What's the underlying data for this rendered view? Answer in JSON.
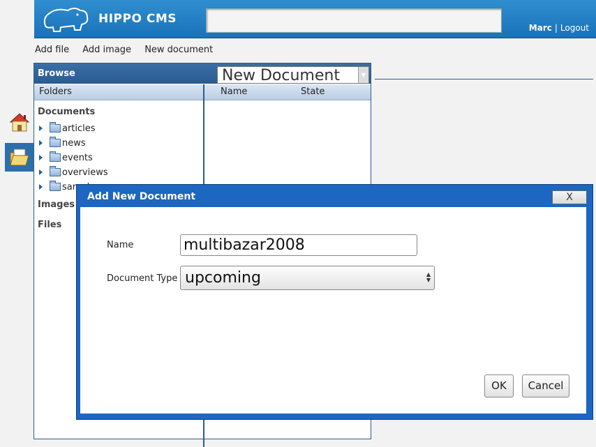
{
  "header": {
    "logo_text": "HIPPO CMS",
    "search_value": "",
    "user": "Marc",
    "separator": "|",
    "logout": "Logout"
  },
  "actions": [
    "Add file",
    "Add image",
    "New document"
  ],
  "browse": {
    "title": "Browse",
    "new_document_select": "New Document",
    "folders_label": "Folders",
    "columns": [
      "Name",
      "State"
    ],
    "tree": {
      "documents_label": "Documents",
      "folders": [
        "articles",
        "news",
        "events",
        "overviews",
        "sample"
      ],
      "images_label": "Images",
      "files_label": "Files"
    }
  },
  "dialog": {
    "title": "Add New Document",
    "close_label": "X",
    "name_label": "Name",
    "name_value": "multibazar2008",
    "type_label": "Document Type",
    "type_value": "upcoming",
    "ok_label": "OK",
    "cancel_label": "Cancel"
  },
  "icons": {
    "logo": "hippo-icon",
    "home": "home-icon",
    "documents": "folder-documents-icon"
  },
  "colors": {
    "header_blue": "#1a72b9",
    "dialog_blue": "#1d66c1",
    "panel_navy": "#2e5b8e"
  }
}
